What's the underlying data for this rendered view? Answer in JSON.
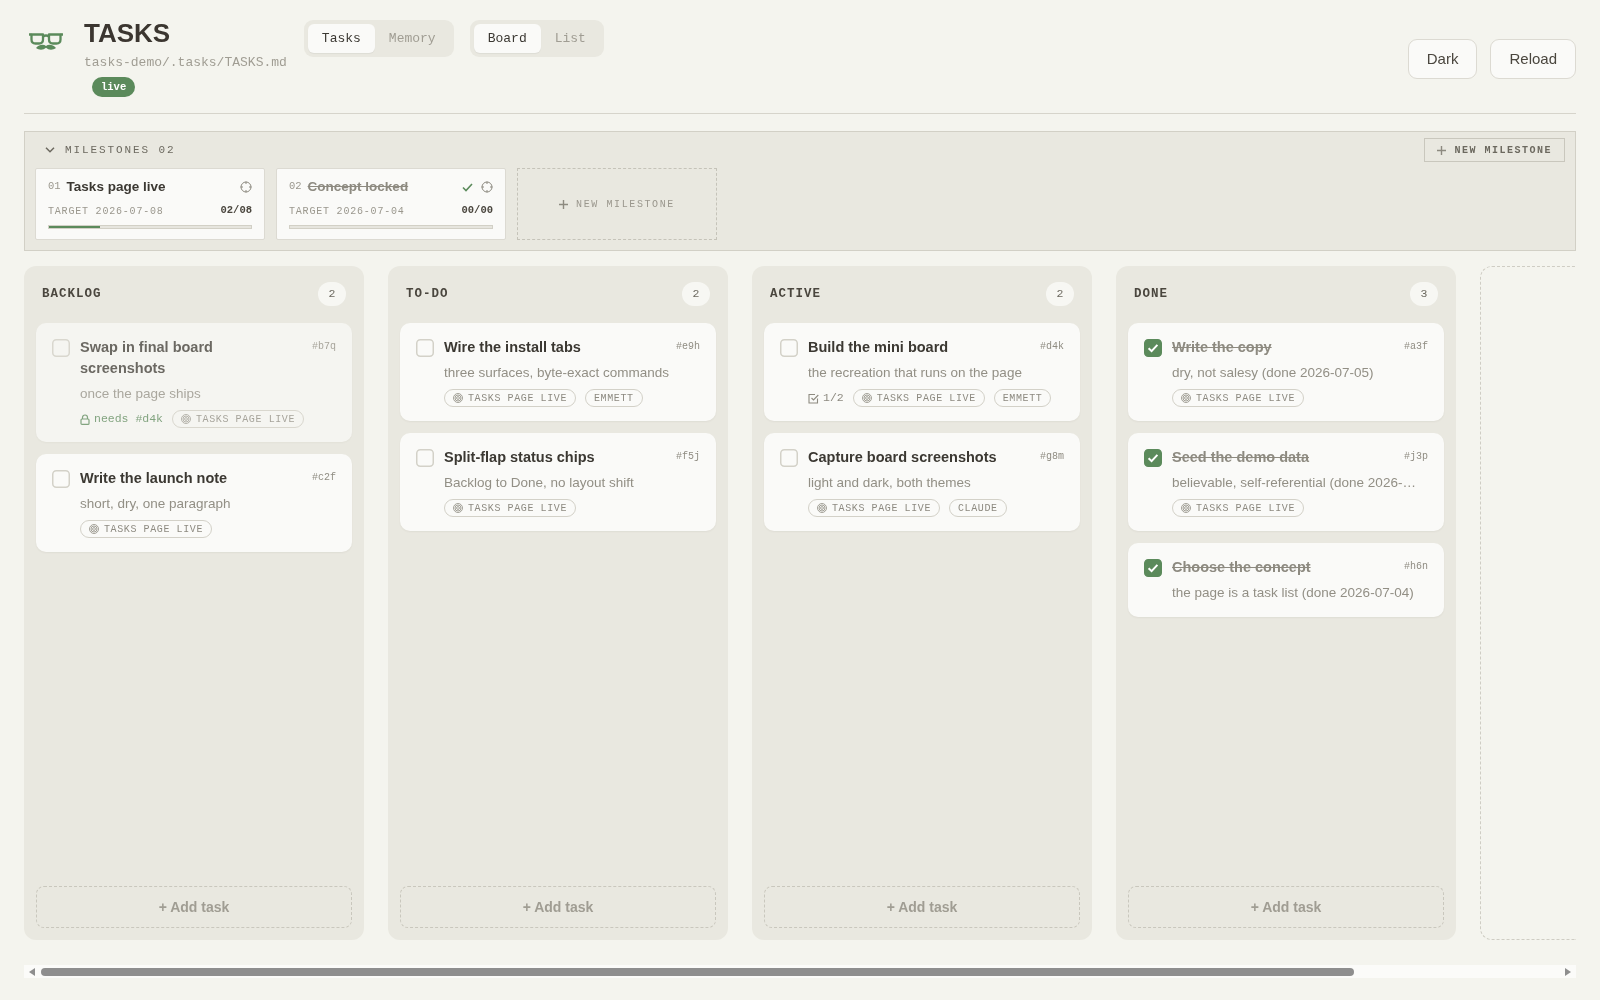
{
  "header": {
    "title": "TASKS",
    "path": "tasks-demo/.tasks/TASKS.md",
    "status": "live"
  },
  "view_tabs": [
    {
      "label": "Tasks",
      "selected": true
    },
    {
      "label": "Memory",
      "selected": false
    }
  ],
  "layout_tabs": [
    {
      "label": "Board",
      "selected": true
    },
    {
      "label": "List",
      "selected": false
    }
  ],
  "actions": [
    "Dark",
    "Reload"
  ],
  "milestones": {
    "title": "MILESTONES 02",
    "expanded": true,
    "new_button": "NEW MILESTONE",
    "items": [
      {
        "number": "01",
        "name": "Tasks page live",
        "done": false,
        "target": "TARGET 2026-07-08",
        "tally": "02/08",
        "level": 0.25
      },
      {
        "number": "02",
        "name": "Concept locked",
        "done": true,
        "target": "TARGET 2026-07-04",
        "tally": "00/00",
        "level": 0
      }
    ],
    "add_card": "NEW MILESTONE"
  },
  "columns": [
    {
      "title": "BACKLOG",
      "count": "2",
      "tasks": [
        {
          "title": "Swap in final board screenshots",
          "id": "#b7q",
          "description": "once the page ships",
          "checked": false,
          "blocked": true,
          "dependency": "needs #d4k",
          "tags": [
            {
              "kind": "milestone",
              "label": "TASKS PAGE LIVE"
            }
          ]
        },
        {
          "title": "Write the launch note",
          "id": "#c2f",
          "description": "short, dry, one paragraph",
          "checked": false,
          "blocked": false,
          "tags": [
            {
              "kind": "milestone",
              "label": "TASKS PAGE LIVE"
            }
          ]
        }
      ],
      "add_label": "+ Add task"
    },
    {
      "title": "TO-DO",
      "count": "2",
      "tasks": [
        {
          "title": "Wire the install tabs",
          "id": "#e9h",
          "description": "three surfaces, byte-exact commands",
          "checked": false,
          "blocked": false,
          "tags": [
            {
              "kind": "milestone",
              "label": "TASKS PAGE LIVE"
            },
            {
              "kind": "person",
              "label": "EMMETT"
            }
          ]
        },
        {
          "title": "Split-flap status chips",
          "id": "#f5j",
          "description": "Backlog to Done, no layout shift",
          "checked": false,
          "blocked": false,
          "tags": [
            {
              "kind": "milestone",
              "label": "TASKS PAGE LIVE"
            }
          ]
        }
      ],
      "add_label": "+ Add task"
    },
    {
      "title": "ACTIVE",
      "count": "2",
      "tasks": [
        {
          "title": "Build the mini board",
          "id": "#d4k",
          "description": "the recreation that runs on the page",
          "checked": false,
          "blocked": false,
          "subtasks": "1/2",
          "tags": [
            {
              "kind": "milestone",
              "label": "TASKS PAGE LIVE"
            },
            {
              "kind": "person",
              "label": "EMMETT"
            }
          ]
        },
        {
          "title": "Capture board screenshots",
          "id": "#g8m",
          "description": "light and dark, both themes",
          "checked": false,
          "blocked": false,
          "tags": [
            {
              "kind": "milestone",
              "label": "TASKS PAGE LIVE"
            },
            {
              "kind": "person",
              "label": "CLAUDE"
            }
          ]
        }
      ],
      "add_label": "+ Add task"
    },
    {
      "title": "DONE",
      "count": "3",
      "tasks": [
        {
          "title": "Write the copy",
          "id": "#a3f",
          "description": "dry, not salesy (done 2026-07-05)",
          "checked": true,
          "blocked": false,
          "tags": [
            {
              "kind": "milestone",
              "label": "TASKS PAGE LIVE"
            }
          ]
        },
        {
          "title": "Seed the demo data",
          "id": "#j3p",
          "description": "believable, self-referential (done 2026-…",
          "checked": true,
          "blocked": false,
          "tags": [
            {
              "kind": "milestone",
              "label": "TASKS PAGE LIVE"
            }
          ]
        },
        {
          "title": "Choose the concept",
          "id": "#h6n",
          "description": "the page is a task list (done 2026-07-04)",
          "checked": true,
          "blocked": false
        }
      ],
      "add_label": "+ Add task"
    }
  ]
}
